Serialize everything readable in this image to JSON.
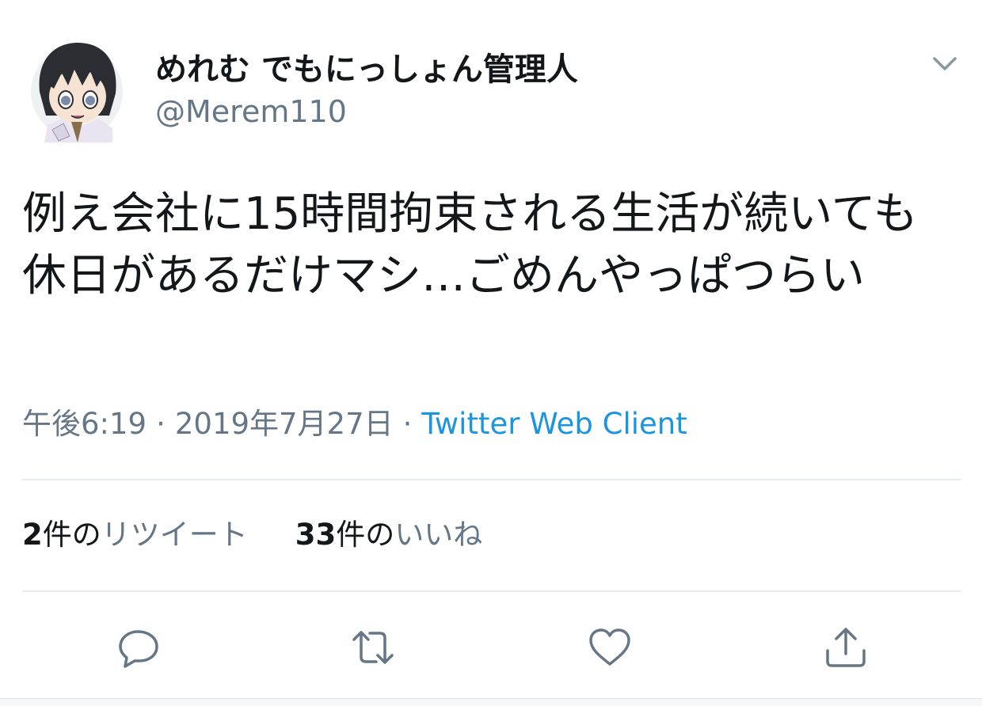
{
  "user": {
    "display_name": "めれむ でもにっしょん管理人",
    "handle": "@Merem110"
  },
  "tweet": {
    "text": "例え会社に15時間拘束される生活が続いても休日があるだけマシ…ごめんやっぱつらい",
    "time": "午後6:19",
    "separator": "·",
    "date": "2019年7月27日",
    "source": "Twitter Web Client"
  },
  "stats": {
    "retweets_count": "2",
    "retweets_unit": "件の",
    "retweets_label": "リツイート",
    "likes_count": "33",
    "likes_unit": "件の",
    "likes_label": "いいね"
  },
  "icons": {
    "menu": "chevron-down-icon",
    "reply": "reply-icon",
    "retweet": "retweet-icon",
    "like": "heart-icon",
    "share": "share-icon"
  },
  "colors": {
    "text": "#14171a",
    "muted": "#657786",
    "link": "#1b95e0",
    "divider": "#e6ecf0"
  }
}
